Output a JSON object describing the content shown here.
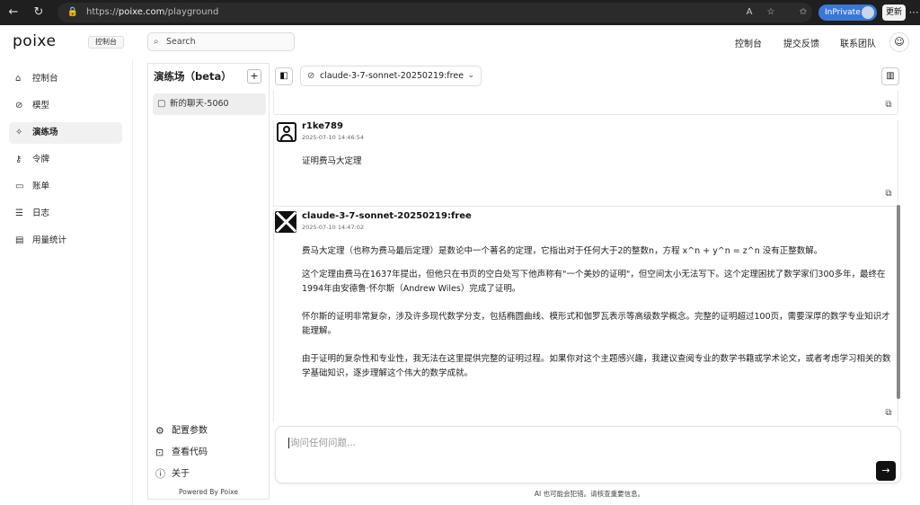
{
  "browser": {
    "url_prefix": "https://",
    "url_host": "poixe.com",
    "url_path": "/playground",
    "inprivate_label": "InPrivate",
    "update_label": "更新"
  },
  "header": {
    "logo": "poixe",
    "console_tag": "控制台",
    "search_placeholder": "Search",
    "links": [
      "控制台",
      "提交反馈",
      "联系团队"
    ]
  },
  "sidebar": {
    "items": [
      {
        "label": "控制台",
        "icon": "home-icon",
        "active": false
      },
      {
        "label": "模型",
        "icon": "model-icon",
        "active": false
      },
      {
        "label": "演练场",
        "icon": "sparkle-icon",
        "active": true
      },
      {
        "label": "令牌",
        "icon": "key-icon",
        "active": false
      },
      {
        "label": "账单",
        "icon": "card-icon",
        "active": false
      },
      {
        "label": "日志",
        "icon": "list-icon",
        "active": false
      },
      {
        "label": "用量统计",
        "icon": "chart-icon",
        "active": false
      }
    ]
  },
  "playground": {
    "title": "演练场（beta）",
    "chats": [
      {
        "label": "新的聊天-5060"
      }
    ],
    "footer": [
      {
        "label": "配置参数",
        "icon": "gear-icon"
      },
      {
        "label": "查看代码",
        "icon": "code-icon"
      },
      {
        "label": "关于",
        "icon": "info-icon"
      }
    ],
    "powered_by": "Powered By Poixe"
  },
  "chat": {
    "model": "claude-3-7-sonnet-20250219:free",
    "messages": [
      {
        "author": "r1ke789",
        "time": "2025-07-10 14:46:54",
        "paragraphs": [
          "证明费马大定理"
        ]
      },
      {
        "author": "claude-3-7-sonnet-20250219:free",
        "time": "2025-07-10 14:47:02",
        "paragraphs": [
          "费马大定理（也称为费马最后定理）是数论中一个著名的定理，它指出对于任何大于2的整数n，方程 x^n + y^n = z^n 没有正整数解。",
          "这个定理由费马在1637年提出，但他只在书页的空白处写下他声称有\"一个美妙的证明\"，但空间太小无法写下。这个定理困扰了数学家们300多年，最终在1994年由安德鲁·怀尔斯（Andrew Wiles）完成了证明。",
          "怀尔斯的证明非常复杂，涉及许多现代数学分支，包括椭圆曲线、模形式和伽罗瓦表示等高级数学概念。完整的证明超过100页，需要深厚的数学专业知识才能理解。",
          "由于证明的复杂性和专业性，我无法在这里提供完整的证明过程。如果你对这个主题感兴趣，我建议查阅专业的数学书籍或学术论文，或者考虑学习相关的数学基础知识，逐步理解这个伟大的数学成就。"
        ]
      }
    ],
    "input_placeholder": "询问任何问题...",
    "disclaimer": "AI 也可能会犯错。请核查重要信息。"
  }
}
